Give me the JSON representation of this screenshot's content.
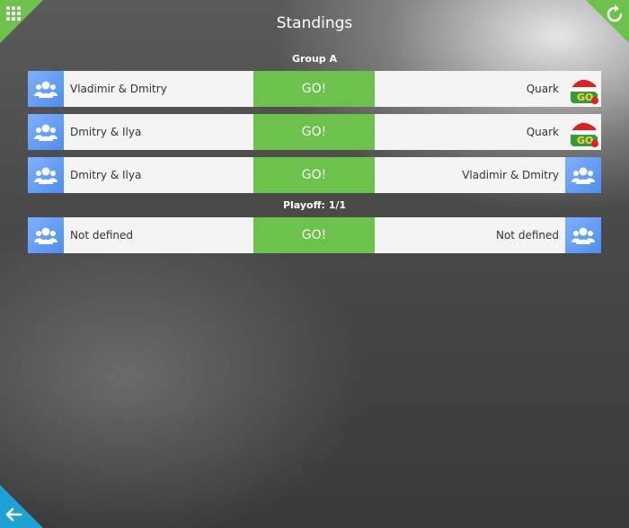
{
  "header": {
    "title": "Standings"
  },
  "groups": [
    {
      "label": "Group A",
      "matches": [
        {
          "left": "Vladimir & Dmitry",
          "go": "GO!",
          "right": "Quark"
        },
        {
          "left": "Dmitry & Ilya",
          "go": "GO!",
          "right": "Quark"
        },
        {
          "left": "Dmitry & Ilya",
          "go": "GO!",
          "right": "Vladimir & Dmitry"
        }
      ]
    },
    {
      "label": "Playoff: 1/1",
      "matches": [
        {
          "left": "Not defined",
          "go": "GO!",
          "right": "Not defined"
        }
      ]
    }
  ],
  "icons": {
    "menu": "grid-menu-icon",
    "refresh": "refresh-icon",
    "back": "back-arrow-icon",
    "team": "team-avatar-icon",
    "quark": "quark-santa-avatar"
  },
  "colors": {
    "accent_green": "#6cc24a",
    "accent_blue": "#1ea2d6",
    "avatar_blue": "#5c9af5",
    "row_bg": "#f4f4f4"
  }
}
